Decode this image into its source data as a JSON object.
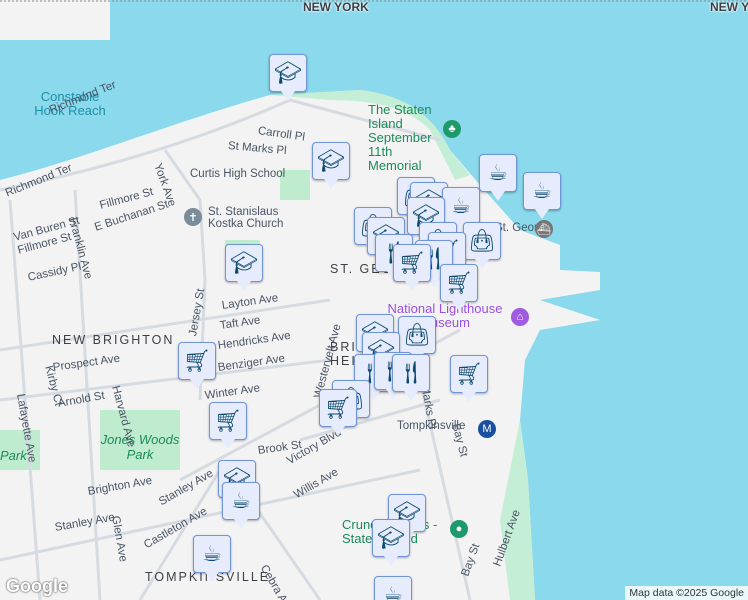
{
  "map": {
    "regions": [
      "NEW YORK",
      "NEW YORK"
    ],
    "water_labels": [
      "Constable Hook Reach"
    ],
    "areas": [
      "NEW BRIGHTON",
      "ST. GEORGE",
      "BRIGHTON HEIGHTS",
      "TOMPKINSVILLE"
    ],
    "parks": [
      "Jones Woods Park",
      "Park"
    ],
    "pois": {
      "memorial": "The Staten Island September 11th Memorial",
      "church": "St. Stanislaus Kostka Church",
      "school": "Curtis High School",
      "museum": "National Lighthouse Museum",
      "station": "Tompkinsville",
      "ferry": "St. George",
      "crunch": "Crunch Fitness - Staten Island"
    },
    "streets": [
      "Richmond Ter",
      "Richmond Ter",
      "Carroll Pl",
      "St Marks Pl",
      "York Ave",
      "Van Buren St",
      "Fillmore St",
      "Fillmore St",
      "Franklin Ave",
      "E Buchanan St",
      "Harvard Ave",
      "Cassidy Pl",
      "Kirby Ct",
      "Lafayette Ave",
      "Jersey St",
      "Layton Ave",
      "Taft Ave",
      "Hendricks Ave",
      "Benziger Ave",
      "Prospect Ave",
      "Arnold St",
      "Winter Ave",
      "Brook St",
      "Victory Blvd",
      "Willis Ave",
      "Brighton Ave",
      "Stanley Ave",
      "Stanley Ave",
      "Glen Ave",
      "Castleton Ave",
      "Cebra Ave",
      "Bay St",
      "Bay St",
      "Hulbert Ave",
      "St Marks Pl",
      "Westervelt Ave"
    ]
  },
  "markers": [
    "school",
    "school",
    "coffee",
    "coffee",
    "bag",
    "school",
    "coffee",
    "school",
    "bag",
    "school",
    "bag",
    "bag",
    "cart",
    "fork",
    "fork",
    "cart",
    "cart",
    "school",
    "cart",
    "school",
    "bag",
    "school",
    "fork",
    "fork",
    "fork",
    "cart",
    "bag",
    "cart",
    "cart",
    "school",
    "coffee",
    "coffee",
    "school",
    "school",
    "coffee"
  ],
  "attribution": "Map data ©2025 Google",
  "logo": "Google"
}
